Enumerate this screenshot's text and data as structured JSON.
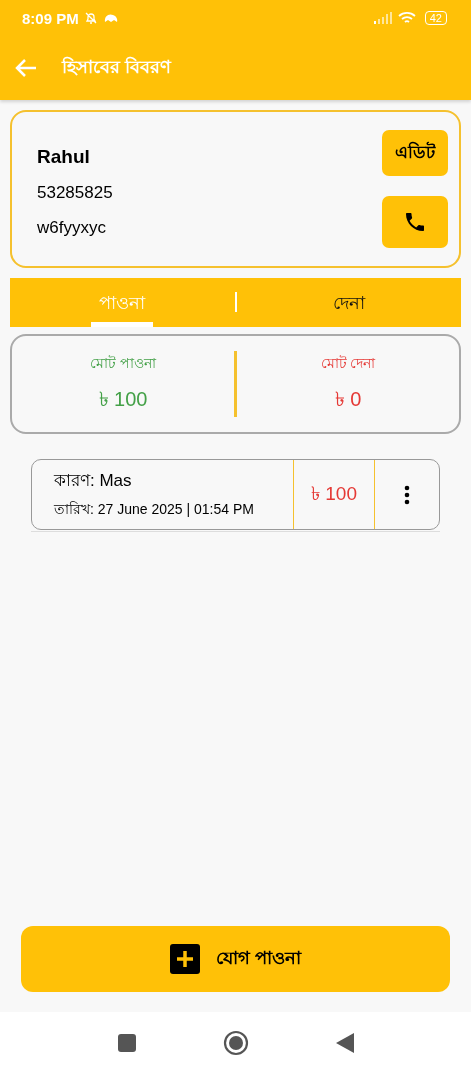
{
  "status_bar": {
    "time": "8:09 PM",
    "battery": "42"
  },
  "app_bar": {
    "title": "হিসাবের বিবরণ"
  },
  "contact": {
    "name": "Rahul",
    "phone": "53285825",
    "code": "w6fyyxyc",
    "edit_label": "এডিট"
  },
  "tabs": [
    {
      "label": "পাওনা",
      "selected": true
    },
    {
      "label": "দেনা",
      "selected": false
    }
  ],
  "summary": [
    {
      "kind": "credit",
      "label": "মোট পাওনা",
      "amount": "৳ 100"
    },
    {
      "kind": "debit",
      "label": "মোট দেনা",
      "amount": "৳ 0"
    }
  ],
  "entries": [
    {
      "reason": "কারণ: Mas",
      "date": "তারিখ: 27 June 2025 | 01:54 PM",
      "amount": "৳ 100"
    }
  ],
  "add_button": {
    "label": "যোগ পাওনা"
  }
}
